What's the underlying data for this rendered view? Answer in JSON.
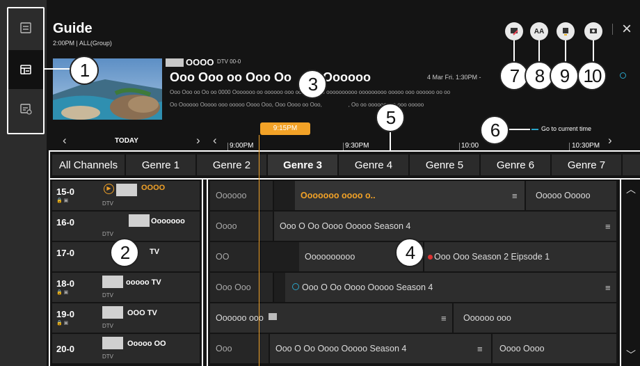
{
  "guide": {
    "title": "Guide",
    "subtitle": "2:00PM | ALL(Group)"
  },
  "preview": {
    "channel_label": "OOOO",
    "channel_badge": "DTV 00-0",
    "program_title": "Ooo Ooo oo Ooo Oo         Oooooo",
    "date": "4 Mar Fri. 1:30PM -",
    "desc1": "Ooo Ooo oo Oo oo 0000 Ooooooo oo oooooo ooo oooooooo o oooooooooo ooooooooo ooooo ooo oooooo oo oo",
    "desc2": "Oo Oooooo Ooooo ooo ooooo Oooo Ooo, Ooo Oooo oo Ooo,                 , Oo oo ooooooooo ooo ooooo"
  },
  "timeline": {
    "nav_today": "TODAY",
    "current_time": "9:15PM",
    "times": [
      "9:00PM",
      "9:30PM",
      "10:00",
      "10:30PM"
    ],
    "go_current": "Go to current time"
  },
  "genres": [
    "All Channels",
    "Genre 1",
    "Genre 2",
    "Genre 3",
    "Genre 4",
    "Genre 5",
    "Genre 6",
    "Genre 7"
  ],
  "channels": [
    {
      "num": "15-0",
      "name": "OOOO",
      "dtv": "DTV"
    },
    {
      "num": "16-0",
      "name": "Ooooooo",
      "dtv": "DTV"
    },
    {
      "num": "17-0",
      "name": "TV",
      "dtv": ""
    },
    {
      "num": "18-0",
      "name": "ooooo TV",
      "dtv": "DTV"
    },
    {
      "num": "19-0",
      "name": "OOO TV",
      "dtv": "DTV"
    },
    {
      "num": "20-0",
      "name": "Ooooo OO",
      "dtv": "DTV"
    }
  ],
  "programs": [
    [
      "Oooooo",
      "Ooooooo oooo o..",
      "Ooooo Ooooo"
    ],
    [
      "Oooo",
      "Ooo O Oo Oooo Ooooo Season 4"
    ],
    [
      "OO",
      "Oooooooooo",
      "Ooo Ooo Season 2 Eipsode 1"
    ],
    [
      "Ooo Ooo",
      "Ooo O Oo Oooo Ooooo Season 4"
    ],
    [
      "Oooooo ooo",
      "Oooooo ooo"
    ],
    [
      "Ooo",
      "Ooo O Oo Oooo Ooooo Season 4",
      "Oooo Oooo"
    ]
  ],
  "callouts": [
    "1",
    "2",
    "3",
    "4",
    "5",
    "6",
    "7",
    "8",
    "9",
    "10"
  ],
  "icons": {
    "sidebar": [
      "list-icon",
      "guide-icon",
      "schedule-icon"
    ],
    "top": [
      "edit-icon",
      "text-size-icon",
      "recording-icon",
      "record-schedule-icon"
    ],
    "close": "×"
  },
  "colors": {
    "accent": "#f2a227",
    "bg": "#141414",
    "row": "#2d2d2d",
    "info": "#2aa4c8"
  }
}
